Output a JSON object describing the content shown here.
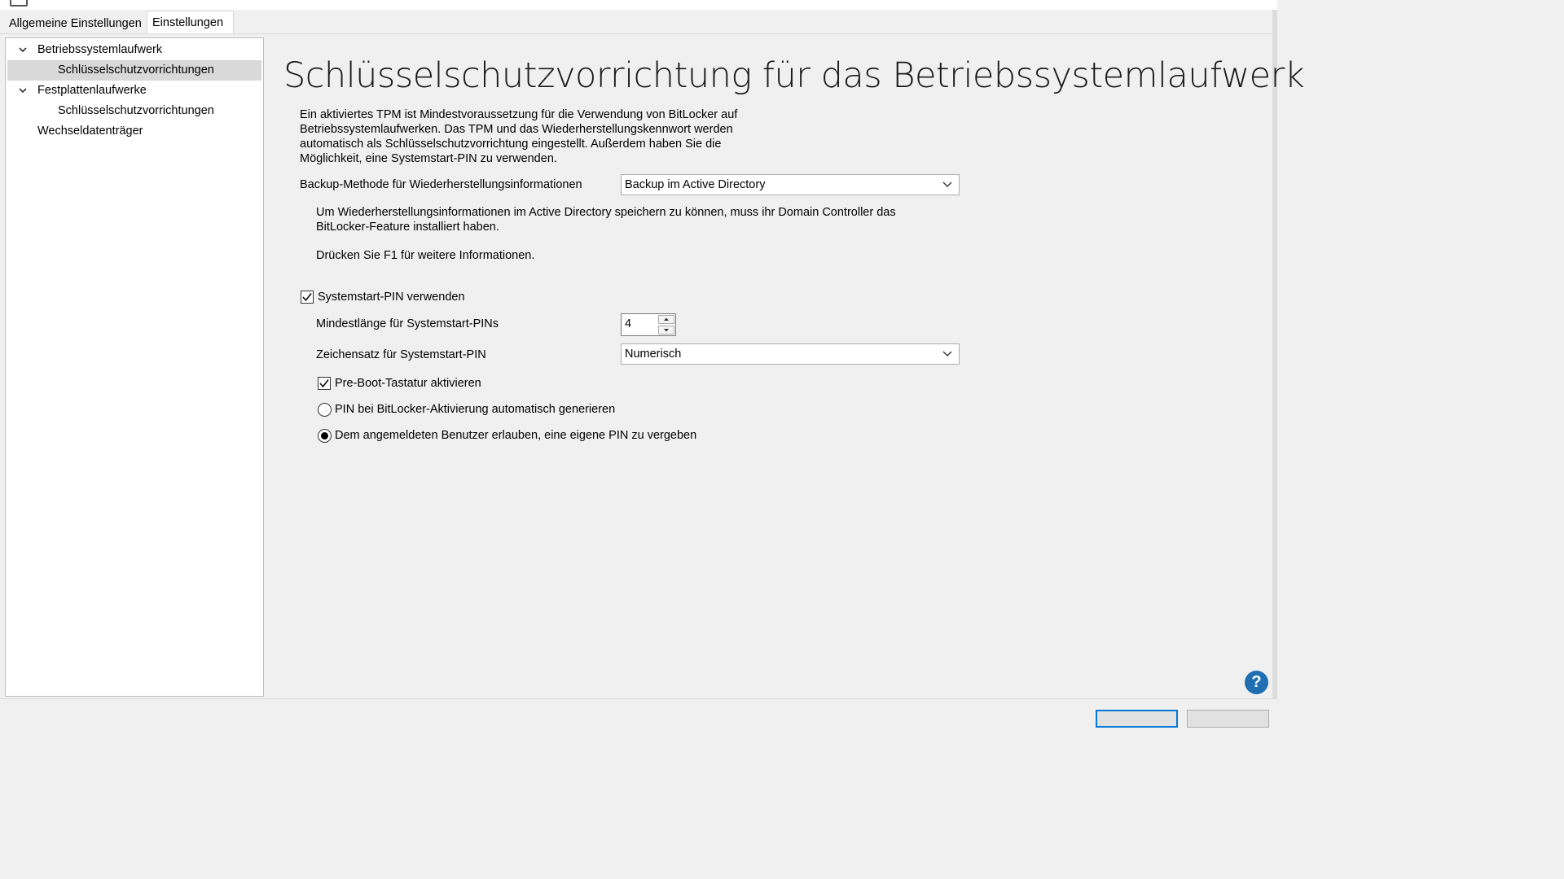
{
  "tabs": [
    {
      "label": "Allgemeine Einstellungen"
    },
    {
      "label": "Einstellungen"
    }
  ],
  "tree": {
    "items": [
      {
        "label": "Betriebssystemlaufwerk"
      },
      {
        "label": "Schlüsselschutzvorrichtungen"
      },
      {
        "label": "Festplattenlaufwerke"
      },
      {
        "label": "Schlüsselschutzvorrichtungen"
      },
      {
        "label": "Wechseldatenträger"
      }
    ]
  },
  "main": {
    "title": "Schlüsselschutzvorrichtung für das Betriebssystemlaufwerk",
    "description": "Ein aktiviertes TPM ist Mindestvoraussetzung für die Verwendung von BitLocker auf Betriebssystemlaufwerken. Das TPM und das Wiederherstellungskennwort werden automatisch als Schlüsselschutzvorrichtung eingestellt. Außerdem haben Sie die Möglichkeit, eine Systemstart-PIN zu verwenden.",
    "backup_label": "Backup-Methode für Wiederherstellungsinformationen",
    "backup_value": "Backup im Active Directory",
    "backup_hint": "Um Wiederherstellungsinformationen im Active Directory speichern zu können, muss ihr Domain Controller das BitLocker-Feature installiert haben.",
    "f1_hint": "Drücken Sie F1 für weitere Informationen.",
    "use_pin_label": "Systemstart-PIN verwenden",
    "min_length_label": "Mindestlänge für Systemstart-PINs",
    "min_length_value": "4",
    "charset_label": "Zeichensatz für Systemstart-PIN",
    "charset_value": "Numerisch",
    "preboot_label": "Pre-Boot-Tastatur aktivieren",
    "radio_auto_label": "PIN bei BitLocker-Aktivierung automatisch generieren",
    "radio_user_label": "Dem angemeldeten Benutzer erlauben, eine eigene PIN zu vergeben"
  },
  "help_label": "?"
}
